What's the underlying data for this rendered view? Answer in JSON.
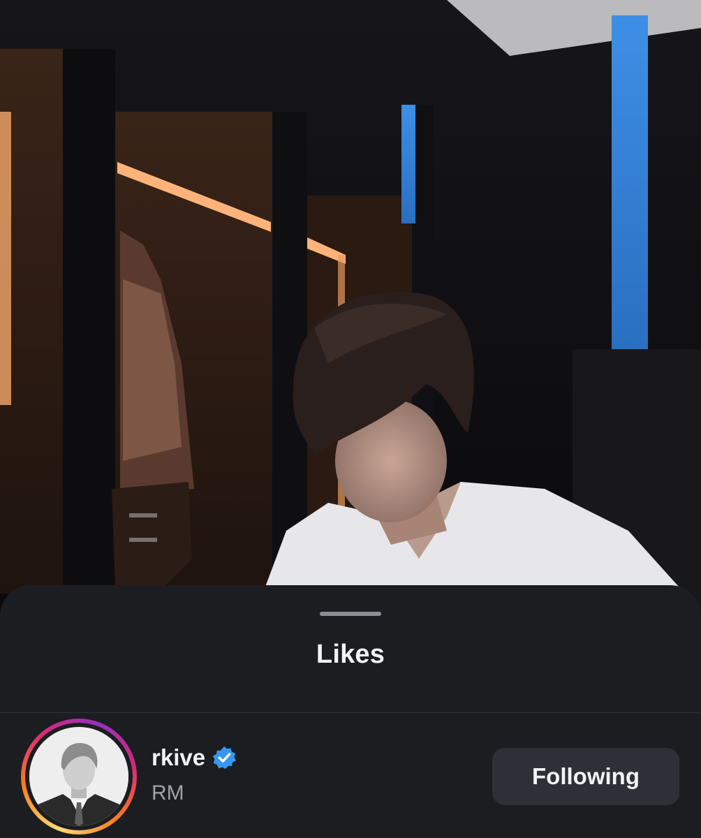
{
  "sheet": {
    "title": "Likes"
  },
  "likes": [
    {
      "username": "rkive",
      "verified": true,
      "full_name": "RM",
      "follow_button_label": "Following"
    }
  ],
  "colors": {
    "sheet_background": "#1b1d21",
    "button_background": "#2d3036",
    "verified_badge": "#3797f0",
    "primary_text": "#f2f3f5",
    "secondary_text": "#9ea2a9"
  }
}
